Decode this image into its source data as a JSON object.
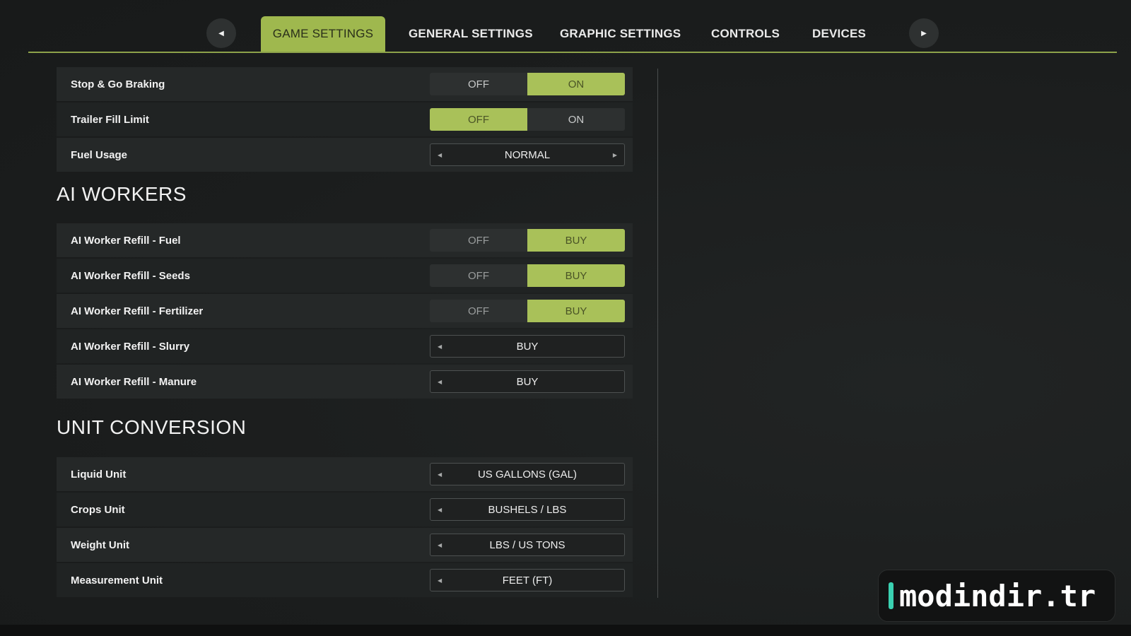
{
  "tabs": {
    "items": [
      {
        "label": "GAME SETTINGS",
        "active": true
      },
      {
        "label": "GENERAL SETTINGS",
        "active": false
      },
      {
        "label": "GRAPHIC SETTINGS",
        "active": false
      },
      {
        "label": "CONTROLS",
        "active": false
      },
      {
        "label": "DEVICES",
        "active": false
      }
    ],
    "prev_icon": "triangle-left",
    "next_icon": "triangle-right"
  },
  "top_settings": [
    {
      "label": "Stop & Go Braking",
      "type": "toggle",
      "options": [
        "OFF",
        "ON"
      ],
      "selected": "ON"
    },
    {
      "label": "Trailer Fill Limit",
      "type": "toggle",
      "options": [
        "OFF",
        "ON"
      ],
      "selected": "OFF"
    },
    {
      "label": "Fuel Usage",
      "type": "selector",
      "value": "NORMAL"
    }
  ],
  "ai_workers": {
    "title": "AI WORKERS",
    "settings": [
      {
        "label": "AI Worker Refill - Fuel",
        "type": "toggle",
        "options": [
          "OFF",
          "BUY"
        ],
        "selected": "BUY"
      },
      {
        "label": "AI Worker Refill - Seeds",
        "type": "toggle",
        "options": [
          "OFF",
          "BUY"
        ],
        "selected": "BUY"
      },
      {
        "label": "AI Worker Refill - Fertilizer",
        "type": "toggle",
        "options": [
          "OFF",
          "BUY"
        ],
        "selected": "BUY"
      },
      {
        "label": "AI Worker Refill - Slurry",
        "type": "selector",
        "value": "BUY"
      },
      {
        "label": "AI Worker Refill - Manure",
        "type": "selector",
        "value": "BUY"
      }
    ]
  },
  "unit_conversion": {
    "title": "UNIT CONVERSION",
    "settings": [
      {
        "label": "Liquid Unit",
        "type": "selector",
        "value": "US GALLONS (GAL)"
      },
      {
        "label": "Crops Unit",
        "type": "selector",
        "value": "BUSHELS / LBS"
      },
      {
        "label": "Weight Unit",
        "type": "selector",
        "value": "LBS / US TONS"
      },
      {
        "label": "Measurement Unit",
        "type": "selector",
        "value": "FEET (FT)"
      }
    ]
  },
  "watermark": {
    "text": "modindir.tr"
  },
  "colors": {
    "accent": "#a9c159",
    "tab_active": "#9fb84e",
    "background": "#1d1f1f",
    "watermark_bar": "#3ad1b1"
  }
}
